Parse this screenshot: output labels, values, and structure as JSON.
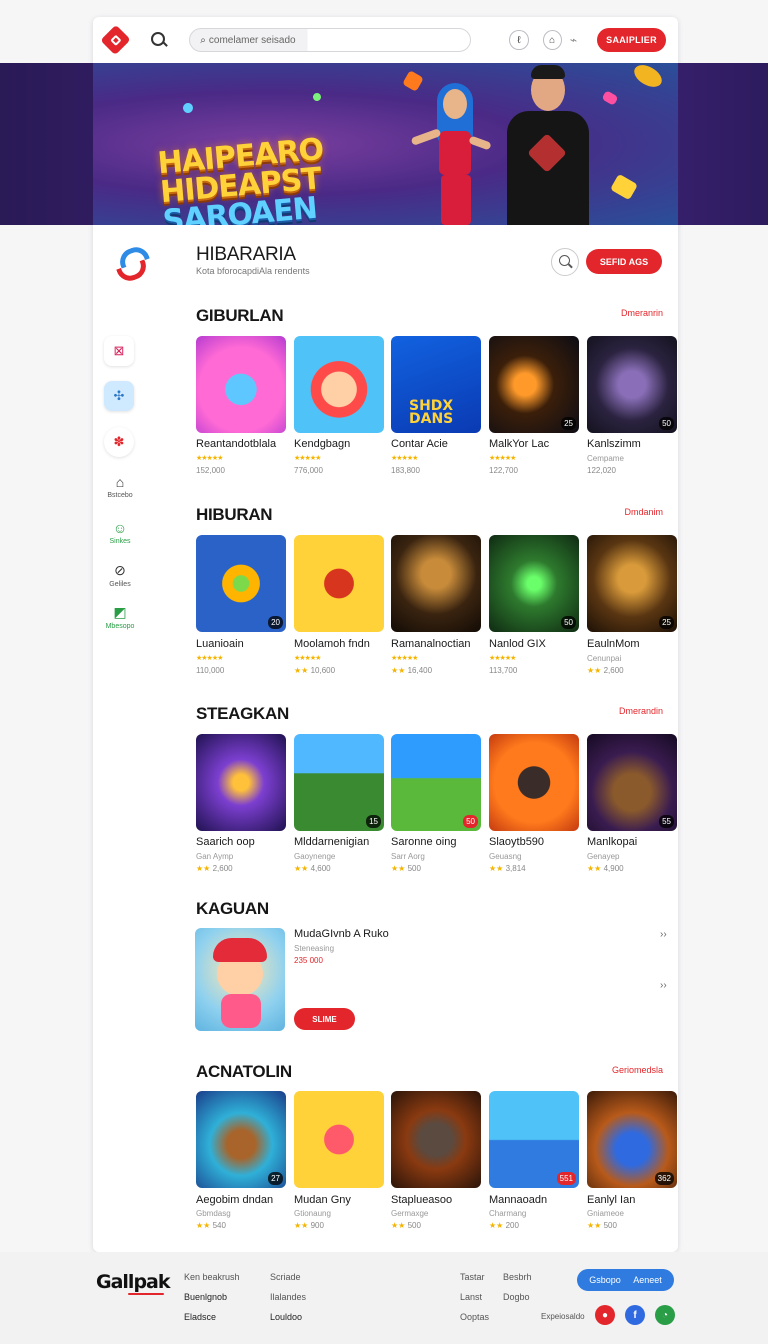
{
  "topbar": {
    "search_placeholder": "comelamer seisado",
    "cta_label": "SAAIPLIER",
    "icon_a": "ℓ",
    "icon_b": "⌂",
    "icon_c": "⌁"
  },
  "hero": {
    "title_line1": "HAIPEARO",
    "title_line2": "HIDEAPST",
    "title_line3": "SAROAEN"
  },
  "brand": {
    "title": "HIBARARIA",
    "subtitle": "Kota bforocapdiAla rendents",
    "button": "SEFID AGS"
  },
  "sidebar": {
    "items": [
      {
        "label": "Bstcebo",
        "icon": "bag-icon"
      },
      {
        "label": "Sinkes",
        "icon": "leaf-icon"
      },
      {
        "label": "Geliles",
        "icon": "chart-icon"
      },
      {
        "label": "Mbesopo",
        "icon": "trend-icon"
      }
    ]
  },
  "sections": [
    {
      "title": "GIBURLAN",
      "more": "Dmeranrin",
      "items": [
        {
          "name": "Reantandotblala",
          "meta": "152,000",
          "badge": ""
        },
        {
          "name": "Kendgbagn",
          "meta": "776,000",
          "badge": ""
        },
        {
          "name": "Contar Acie",
          "meta": "183,800",
          "badge": ""
        },
        {
          "name": "MalkYor Lac",
          "meta": "122,700",
          "badge": "25"
        },
        {
          "name": "Kanlszimm",
          "meta": "122,020",
          "badge": "50",
          "sub": "Cempame"
        }
      ]
    },
    {
      "title": "HIBURAN",
      "more": "Dmdanim",
      "items": [
        {
          "name": "Luanioain",
          "meta": "110,000",
          "badge": "20"
        },
        {
          "name": "Moolamoh fndn",
          "meta": "10,600",
          "badge": ""
        },
        {
          "name": "Ramanalnoctian",
          "meta": "16,400",
          "badge": ""
        },
        {
          "name": "Nanlod GIX",
          "meta": "113,700",
          "badge": "50"
        },
        {
          "name": "EaulnMom",
          "meta": "2,600",
          "badge": "25",
          "sub": "Cenunpai"
        }
      ]
    },
    {
      "title": "STEAGKAN",
      "more": "Dmerandin",
      "items": [
        {
          "name": "Saarich oop",
          "sub": "Gan Aymp",
          "meta": "2,600",
          "badge": ""
        },
        {
          "name": "Mlddarnenigian",
          "sub": "Gaoynenge",
          "meta": "4,600",
          "badge": "15"
        },
        {
          "name": "Saronne oing",
          "sub": "Sarr Aorg",
          "meta": "500",
          "badge": "50"
        },
        {
          "name": "Slaoytb590",
          "sub": "Geuasng",
          "meta": "3,814",
          "badge": ""
        },
        {
          "name": "Manlkopai",
          "sub": "Genayep",
          "meta": "4,900",
          "badge": "55"
        }
      ]
    }
  ],
  "featured": {
    "title": "KAGUAN",
    "name": "MudaGIvnb A Ruko",
    "sub": "Steneasing",
    "price": "235 000",
    "button": "SLIME",
    "chev": "››"
  },
  "last_section": {
    "title": "ACNATOLIN",
    "more": "Geriomedsla",
    "items": [
      {
        "name": "Aegobim dndan",
        "sub": "Gbmdasg",
        "meta": "540",
        "badge": "27"
      },
      {
        "name": "Mudan Gny",
        "sub": "Gtionaung",
        "meta": "900",
        "badge": ""
      },
      {
        "name": "Staplueasoo",
        "sub": "Germaxge",
        "meta": "500",
        "badge": ""
      },
      {
        "name": "Mannaoadn",
        "sub": "Charmang",
        "meta": "200",
        "badge": "551"
      },
      {
        "name": "Eanlyl Ian",
        "sub": "Gniameoe",
        "meta": "500",
        "badge": "362"
      }
    ]
  },
  "footer": {
    "logo": "Gallpak",
    "col1": [
      "Ken beakrush",
      "Buenlgnob",
      "Eladsce"
    ],
    "col2": [
      "Scriade",
      "Ilalandes",
      "Louldoo"
    ],
    "col3": [
      "Tastar",
      "Lanst",
      "Ooptas"
    ],
    "col4": [
      "Besbrh",
      "Dogbo"
    ],
    "col5": "Expeiosaldo",
    "pill_a": "Gsbopo",
    "pill_b": "Aeneet"
  },
  "stars": "★★★★★",
  "stars_two": "★★"
}
